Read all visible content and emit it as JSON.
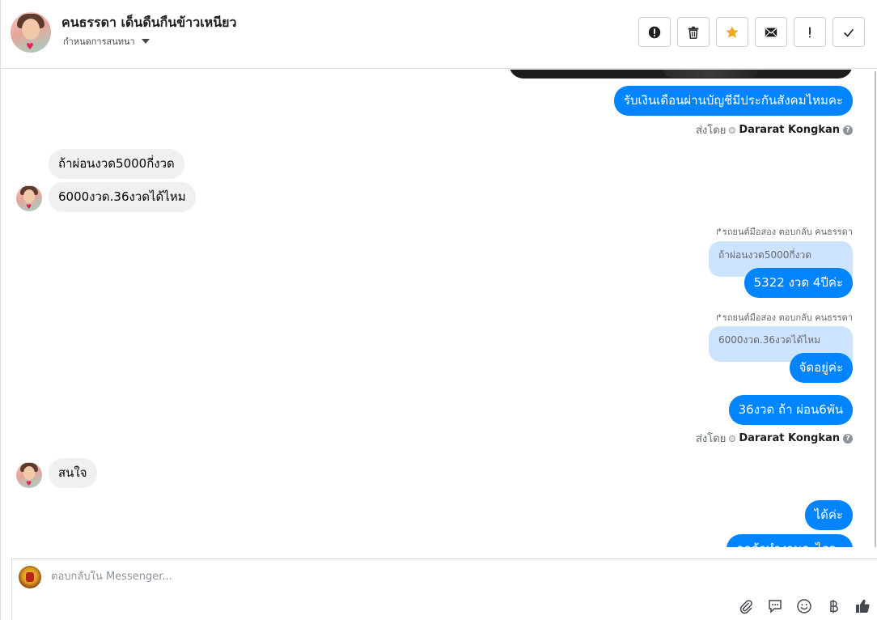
{
  "header": {
    "contact_name": "คนธรรดา เด็นดืนกืนข้าวเหนียว",
    "assign_label": "กำหนดการสนทนา",
    "actions": [
      {
        "name": "mark-spam-button",
        "icon": "alert-circle-icon"
      },
      {
        "name": "delete-button",
        "icon": "trash-icon"
      },
      {
        "name": "star-button",
        "icon": "star-icon"
      },
      {
        "name": "mark-unread-button",
        "icon": "envelope-icon"
      },
      {
        "name": "follow-up-button",
        "icon": "exclamation-icon"
      },
      {
        "name": "mark-done-button",
        "icon": "check-icon"
      }
    ]
  },
  "messages": {
    "out_1": "รับเงินเดือนผ่านบัญชีมีประกันสังคมไหมคะ",
    "sent_by_label": "ส่งโดย",
    "sender_name": "Dararat Kongkan",
    "help_glyph": "?",
    "heart_glyph": "♥",
    "in_1": "ถ้าผ่อนงวด5000กี่งวด",
    "in_2": "6000งวด.36งวดได้ไหม",
    "reply_meta_1": "↱รถยนต์มือสอง ตอบกลับ คนธรรดา",
    "quoted_1": "ถ้าผ่อนงวด5000กี่งวด",
    "out_2": "5322 งวด 4ปีค่ะ",
    "reply_meta_2": "↱รถยนต์มือสอง ตอบกลับ คนธรรดา",
    "quoted_2": "6000งวด.36งวดได้ไหม",
    "out_3": "จัดอยู่ค่ะ",
    "out_4": "36งวด ถ้า ผ่อน6พัน",
    "in_3": "สนใจ",
    "out_5": "ได้ค่ะ",
    "out_6_partial": "ลูกค้าทำงานอะไรคะ"
  },
  "composer": {
    "placeholder": "ตอบกลับใน Messenger...",
    "tools": [
      "paperclip-icon",
      "quick-reply-icon",
      "emoji-icon",
      "baht-icon",
      "thumbs-up-icon"
    ]
  },
  "colors": {
    "outgoing_bubble": "#0084ff",
    "incoming_bubble": "#f0f0f0",
    "quoted_bubble": "#cce4ff",
    "star": "#f5a623"
  }
}
